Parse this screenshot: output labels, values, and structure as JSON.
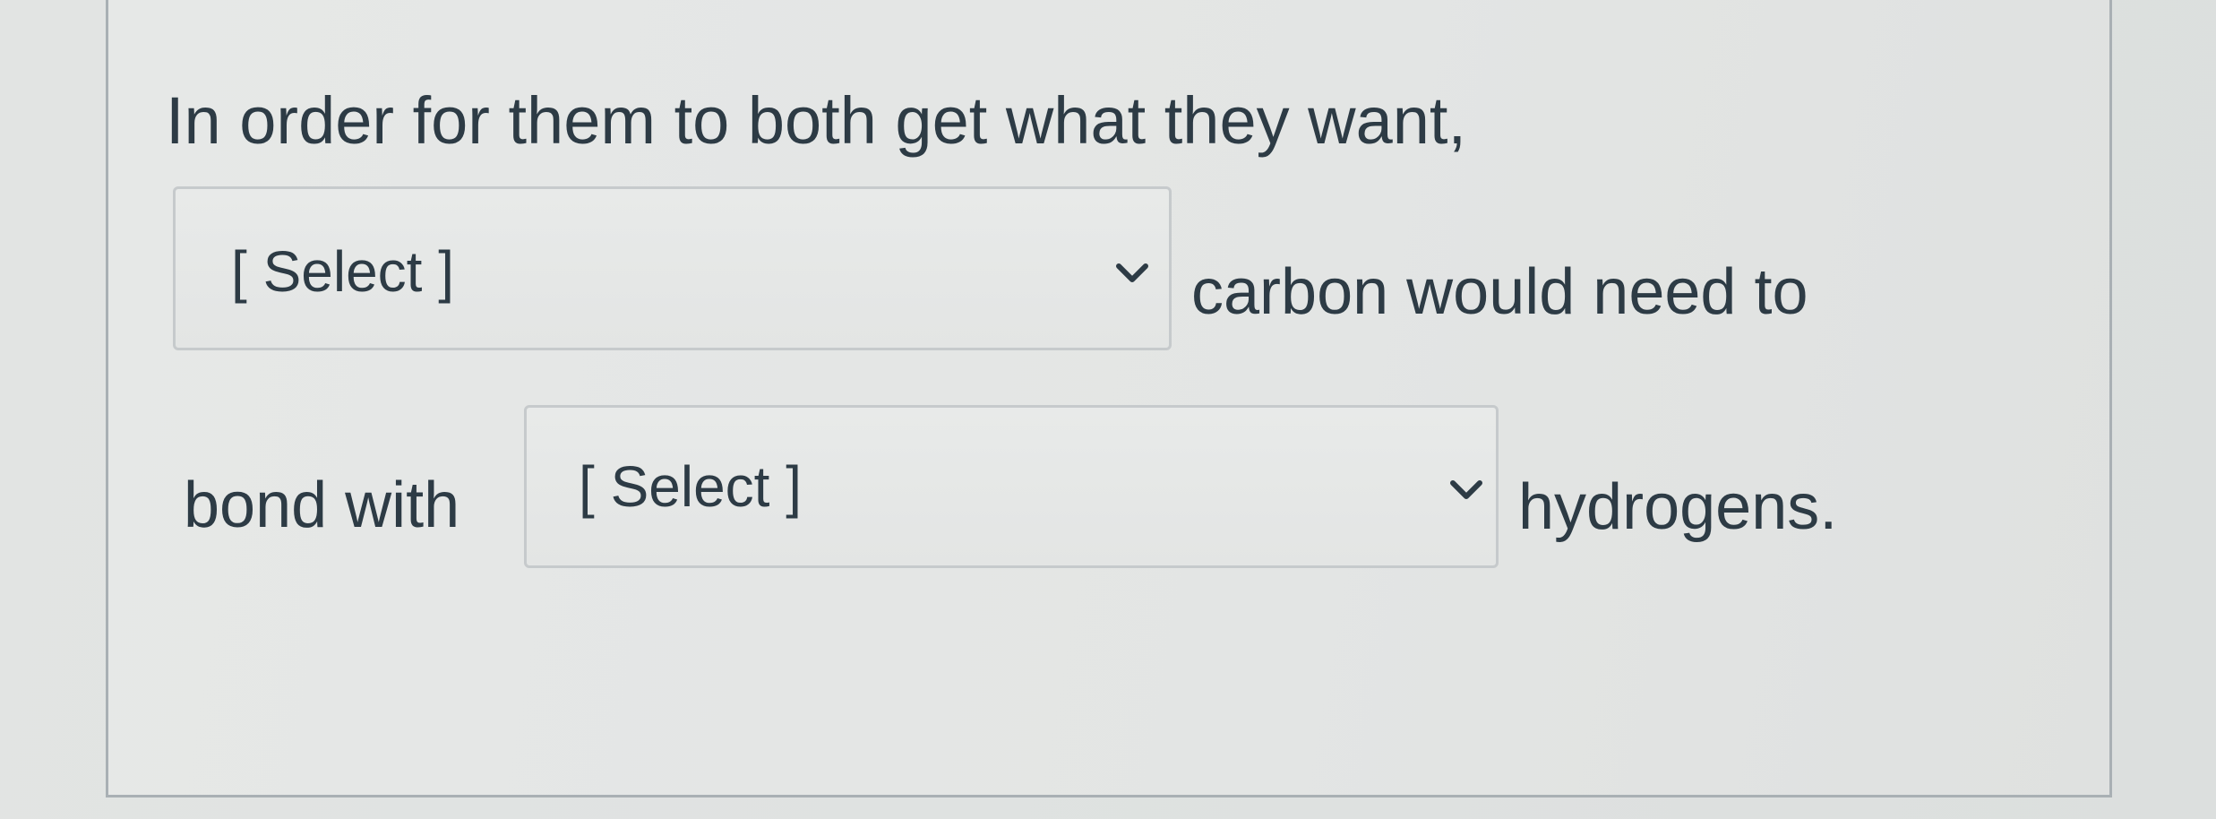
{
  "question": {
    "line1": "In order for them to both get what they want,",
    "after_select1": "carbon would need to",
    "before_select2": "bond with",
    "after_select2": "hydrogens."
  },
  "selects": [
    {
      "selected_label": "[ Select ]",
      "icon": "chevron-down-icon"
    },
    {
      "selected_label": "[ Select ]",
      "icon": "chevron-down-icon"
    }
  ],
  "colors": {
    "text": "#2d3b45",
    "panel_border": "#a9b0b4",
    "select_border": "#c6cacc"
  }
}
